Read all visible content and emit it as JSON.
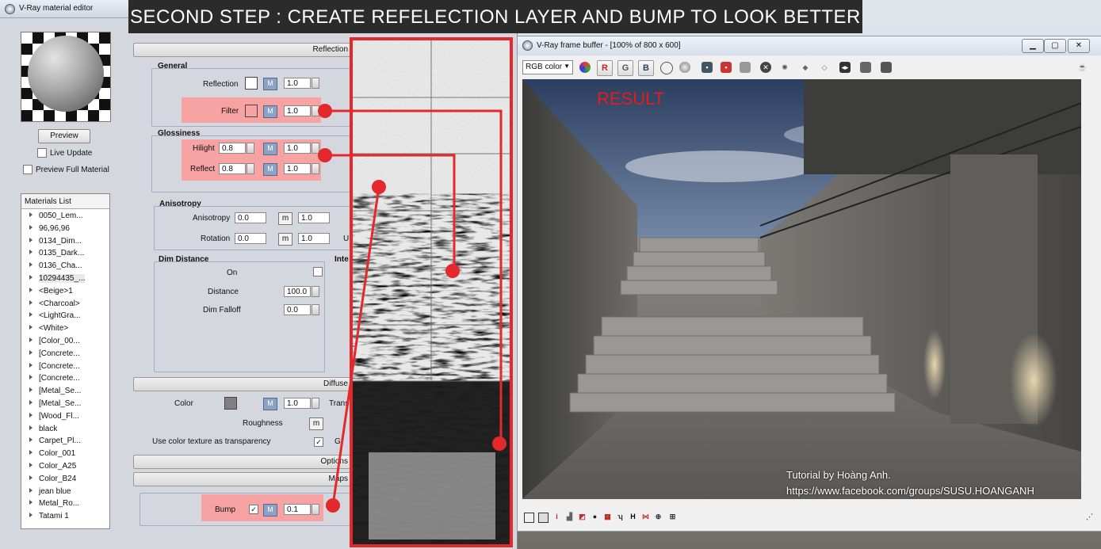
{
  "banner": {
    "text": "SECOND STEP : CREATE REFELECTION LAYER AND BUMP TO LOOK BETTER"
  },
  "material_editor": {
    "title": "V-Ray material editor",
    "preview_button": "Preview",
    "live_update": "Live Update",
    "preview_full": "Preview Full Material",
    "materials_list_label": "Materials List",
    "materials": [
      "0050_Lem...",
      "96,96,96",
      "0134_Dim...",
      "0135_Dark...",
      "0136_Cha...",
      "10294435_...",
      "<Beige>1",
      "<Charcoal>",
      "<LightGra...",
      "<White>",
      "[Color_00...",
      "[Concrete...",
      "[Concrete...",
      "[Concrete...",
      "[Metal_Se...",
      "[Metal_Se...",
      "[Wood_Fl...",
      "black",
      "Carpet_Pl...",
      "Color_001",
      "Color_A25",
      "Color_B24",
      "jean blue",
      "Metal_Ro...",
      "Tatami 1"
    ],
    "reflection_rollout": "Reflection",
    "general": {
      "title": "General",
      "reflection_label": "Reflection",
      "reflection_value": "1.0",
      "filter_label": "Filter",
      "filter_value": "1.0",
      "m": "M"
    },
    "glossiness": {
      "title": "Glossiness",
      "hilight_label": "Hilight",
      "hilight_a": "0.8",
      "hilight_b": "1.0",
      "reflect_label": "Reflect",
      "reflect_a": "0.8",
      "reflect_b": "1.0"
    },
    "anisotropy": {
      "title": "Anisotropy",
      "anisotropy_label": "Anisotropy",
      "anisotropy_a": "0.0",
      "anisotropy_b": "1.0",
      "rotation_label": "Rotation",
      "rotation_a": "0.0",
      "rotation_b": "1.0",
      "m_small": "m",
      "u": "U"
    },
    "dim": {
      "title": "Dim Distance",
      "inter": "Inte",
      "on_label": "On",
      "distance_label": "Distance",
      "distance_value": "100.0",
      "falloff_label": "Dim Falloff",
      "falloff_value": "0.0"
    },
    "diffuse_rollout": "Diffuse",
    "diffuse": {
      "color_label": "Color",
      "color_value": "1.0",
      "trans": "Trans",
      "roughness_label": "Roughness",
      "m_small": "m",
      "use_color_tex": "Use color texture as transparency",
      "gi": "GI"
    },
    "options_rollout": "Options",
    "maps_rollout": "Maps",
    "bump": {
      "label": "Bump",
      "value": "0.1",
      "m": "M"
    },
    "colors": {
      "highlight": "#f7a3a3",
      "marker": "#e3292c",
      "diffuse_swatch": "#808080"
    }
  },
  "frame_buffer": {
    "title": "V-Ray frame buffer - [100% of 800 x 600]",
    "channel": "RGB color",
    "r": "R",
    "g": "G",
    "b": "B",
    "result_label": "RESULT",
    "credit_line1": "Tutorial by Hoàng Anh.",
    "credit_line2": "https://www.facebook.com/groups/SUSU.HOANGANH",
    "status_i": "i",
    "status_h": "H"
  }
}
